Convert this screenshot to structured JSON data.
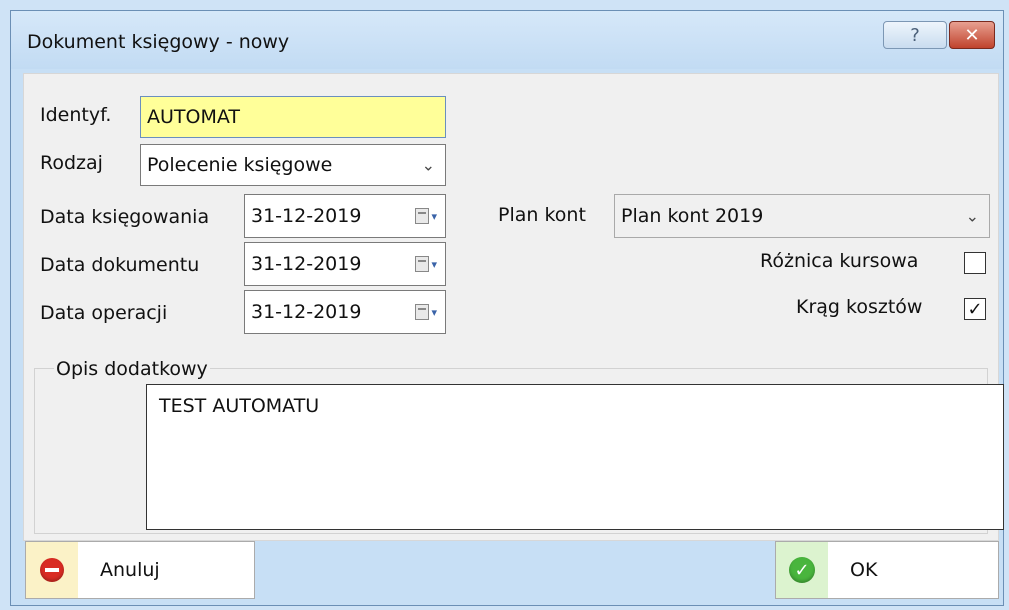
{
  "window": {
    "title": "Dokument księgowy - nowy",
    "help_label": "?",
    "close_label": "✕"
  },
  "form": {
    "identyf": {
      "label": "Identyf.",
      "value": "AUTOMAT"
    },
    "rodzaj": {
      "label": "Rodzaj",
      "value": "Polecenie księgowe"
    },
    "data_ksiegowania": {
      "label": "Data księgowania",
      "value": "31-12-2019"
    },
    "data_dokumentu": {
      "label": "Data dokumentu",
      "value": "31-12-2019"
    },
    "data_operacji": {
      "label": "Data operacji",
      "value": "31-12-2019"
    },
    "plan_kont": {
      "label": "Plan kont",
      "value": "Plan kont 2019"
    },
    "roznica_kursowa": {
      "label": "Różnica kursowa",
      "checked": false
    },
    "krag_kosztow": {
      "label": "Krąg kosztów",
      "checked": true,
      "mark": "✓"
    }
  },
  "opis": {
    "label": "Opis dodatkowy",
    "value": "TEST AUTOMATU"
  },
  "buttons": {
    "cancel": "Anuluj",
    "ok": "OK"
  },
  "icons": {
    "chevron": "⌄",
    "calendar_caret": "▾",
    "ok_check": "✓"
  }
}
